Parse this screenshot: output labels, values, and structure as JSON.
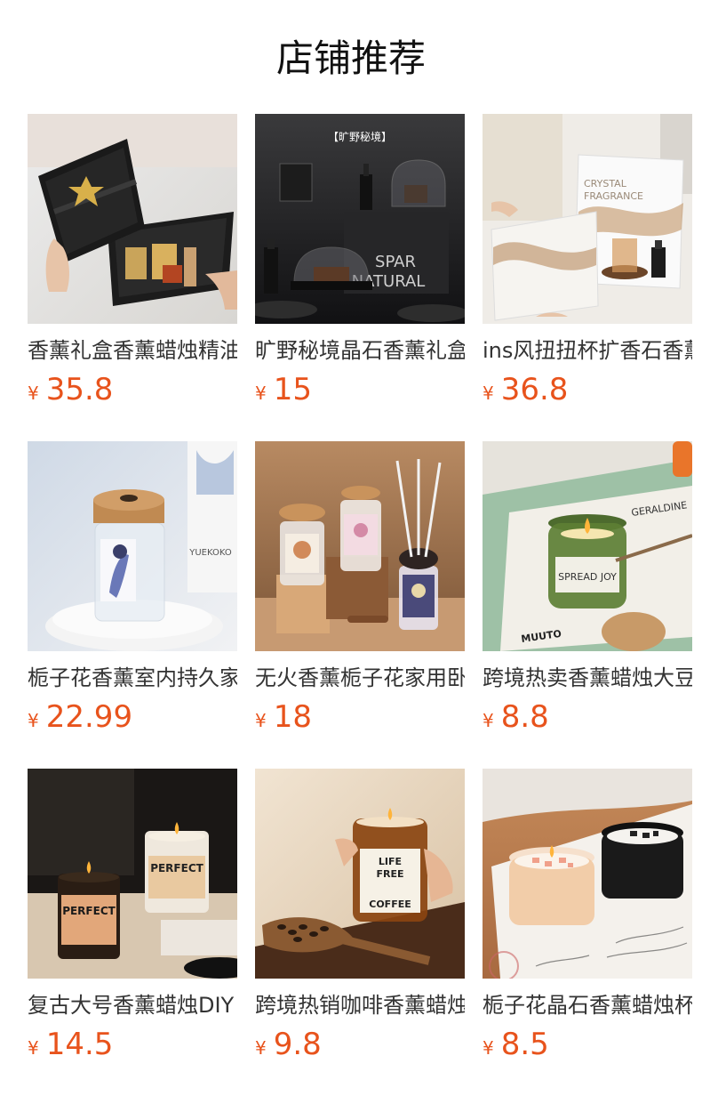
{
  "header": {
    "title": "店铺推荐"
  },
  "products": [
    {
      "name": "香薰礼盒香薰蜡烛精油套装",
      "currency": "¥",
      "price": "35.8",
      "image": "gift-box-candle-image"
    },
    {
      "name": "旷野秘境晶石香薰礼盒装",
      "currency": "¥",
      "price": "15",
      "image": "spar-natural-diffuser-image",
      "image_text": [
        "【旷野秘境】",
        "SPAR",
        "NATURAL"
      ]
    },
    {
      "name": "ins风扭扭杯扩香石香薰",
      "currency": "¥",
      "price": "36.8",
      "image": "crystal-fragrance-set-image",
      "image_text": [
        "CRYSTAL",
        "FRAGRANCE"
      ]
    },
    {
      "name": "栀子花香薰室内持久家用",
      "currency": "¥",
      "price": "22.99",
      "image": "yuekoko-reed-diffuser-image",
      "image_text": [
        "YUEKOKO"
      ]
    },
    {
      "name": "无火香薰栀子花家用卧室",
      "currency": "¥",
      "price": "18",
      "image": "reed-diffuser-trio-image"
    },
    {
      "name": "跨境热卖香薰蜡烛大豆蜡",
      "currency": "¥",
      "price": "8.8",
      "image": "green-jar-candle-image",
      "image_text": [
        "SPREAD JOY",
        "GERALDINE",
        "MUUTO"
      ]
    },
    {
      "name": "复古大号香薰蜡烛DIY",
      "currency": "¥",
      "price": "14.5",
      "image": "perfect-amber-candle-image",
      "image_text": [
        "PERFECT",
        "PERFECT"
      ]
    },
    {
      "name": "跨境热销咖啡香薰蜡烛",
      "currency": "¥",
      "price": "9.8",
      "image": "coffee-candle-image",
      "image_text": [
        "LIFE",
        "FREE",
        "COFFEE"
      ]
    },
    {
      "name": "栀子花晶石香薰蜡烛杯",
      "currency": "¥",
      "price": "8.5",
      "image": "crystal-candle-pair-image"
    }
  ],
  "colors": {
    "price": "#e8531c",
    "text": "#333333",
    "background": "#ffffff"
  }
}
